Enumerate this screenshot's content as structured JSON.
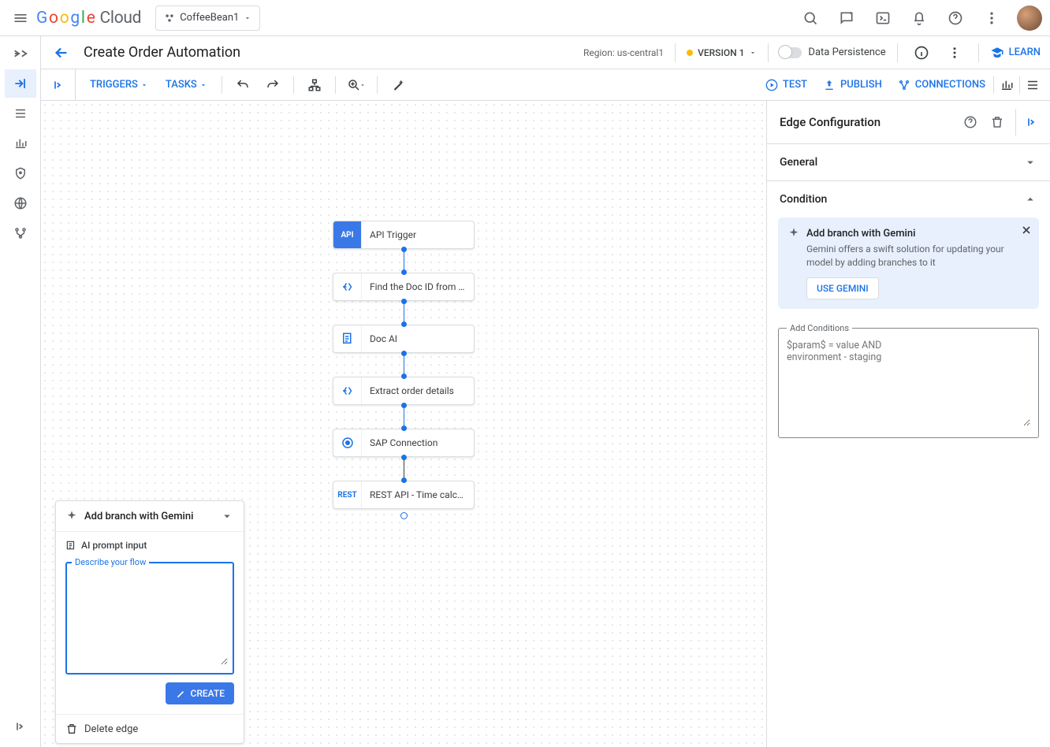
{
  "header": {
    "brand_cloud": "Cloud",
    "project": "CoffeeBean1"
  },
  "page": {
    "title": "Create Order Automation",
    "region_prefix": "Region: ",
    "region": "us-central1",
    "version": "VERSION 1",
    "data_persistence": "Data Persistence",
    "learn": "LEARN"
  },
  "toolbar": {
    "triggers": "TRIGGERS",
    "tasks": "TASKS",
    "test": "TEST",
    "publish": "PUBLISH",
    "connections": "CONNECTIONS"
  },
  "flow_nodes": [
    {
      "icon": "API",
      "label": "API Trigger",
      "style": "api"
    },
    {
      "icon": "map",
      "label": "Find the Doc ID from Input",
      "style": ""
    },
    {
      "icon": "doc",
      "label": "Doc AI",
      "style": ""
    },
    {
      "icon": "map",
      "label": "Extract order details",
      "style": ""
    },
    {
      "icon": "sap",
      "label": "SAP Connection",
      "style": ""
    },
    {
      "icon": "REST",
      "label": "REST API - Time calcul...",
      "style": ""
    }
  ],
  "gemini_card": {
    "title": "Add branch with Gemini",
    "prompt_label": "AI prompt input",
    "fieldset_legend": "Describe your flow",
    "create": "CREATE",
    "delete_edge": "Delete edge"
  },
  "right_panel": {
    "title": "Edge Configuration",
    "general": "General",
    "condition": "Condition",
    "gem_title": "Add branch with Gemini",
    "gem_desc": "Gemini offers a swift solution for updating your model by adding branches to it",
    "gem_btn": "USE GEMINI",
    "cond_legend": "Add Conditions",
    "cond_placeholder": "$param$ = value AND\nenvironment - staging"
  }
}
